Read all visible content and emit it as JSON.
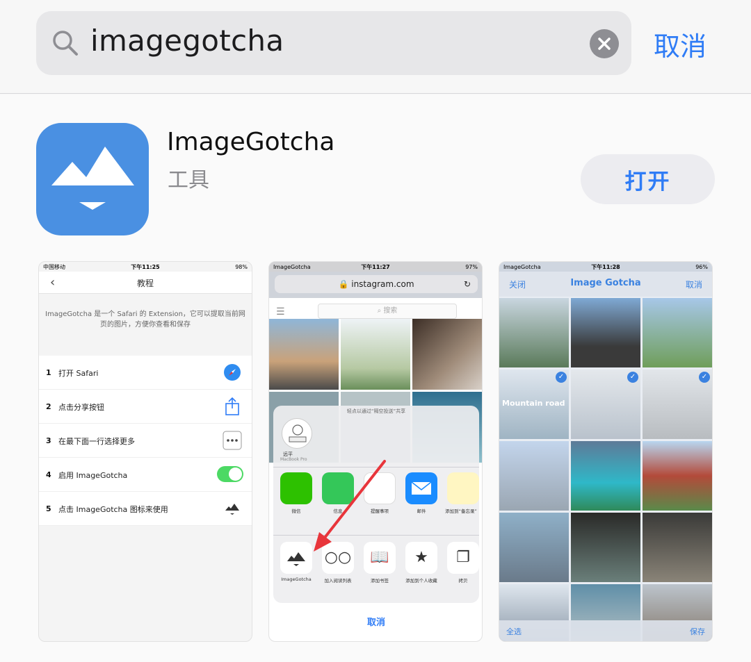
{
  "search": {
    "query": "imagegotcha",
    "cancel_label": "取消"
  },
  "app": {
    "name": "ImageGotcha",
    "category": "工具",
    "open_label": "打开",
    "brand_color": "#4a90e2"
  },
  "screenshots": {
    "shot1": {
      "status": {
        "carrier": "中国移动",
        "time": "下午11:25",
        "battery": "98%"
      },
      "title": "教程",
      "description": "ImageGotcha 是一个 Safari 的 Extension，它可以提取当前网页的图片，方便你查看和保存",
      "steps": [
        {
          "num": "1",
          "label": "打开 Safari",
          "icon": "compass-icon"
        },
        {
          "num": "2",
          "label": "点击分享按钮",
          "icon": "share-icon"
        },
        {
          "num": "3",
          "label": "在最下面一行选择更多",
          "icon": "more-icon"
        },
        {
          "num": "4",
          "label": "启用 ImageGotcha",
          "icon": "toggle-on"
        },
        {
          "num": "5",
          "label": "点击 ImageGotcha 图标来使用",
          "icon": "mountain-icon"
        }
      ]
    },
    "shot2": {
      "status": {
        "app": "ImageGotcha",
        "time": "下午11:27",
        "battery": "97%"
      },
      "url": "instagram.com",
      "search_placeholder": "搜索",
      "share_hint": "轻点以通过“隔空投送”共享",
      "airdrop_name": "远平",
      "airdrop_device": "MacBook Pro",
      "apps": [
        {
          "label": "微信",
          "color": "#2dc100"
        },
        {
          "label": "信息",
          "color": "#34c759"
        },
        {
          "label": "提醒事项",
          "color": "#ffffff"
        },
        {
          "label": "邮件",
          "color": "#1a8cff"
        },
        {
          "label": "添加到“备忘录”",
          "color": "#fff6c2"
        }
      ],
      "actions": [
        {
          "label": "ImageGotcha",
          "glyph": "▲"
        },
        {
          "label": "加入阅读列表",
          "glyph": "○○"
        },
        {
          "label": "添加书签",
          "glyph": "📖"
        },
        {
          "label": "添加到个人收藏",
          "glyph": "★"
        },
        {
          "label": "拷贝",
          "glyph": "❐"
        }
      ],
      "cancel_label": "取消"
    },
    "shot3": {
      "status": {
        "app": "ImageGotcha",
        "time": "下午11:28",
        "battery": "96%"
      },
      "close_label": "关闭",
      "title": "Image Gotcha",
      "cancel_label": "取消",
      "photo_caption": "Mountain road",
      "select_all_label": "全选",
      "save_label": "保存"
    }
  }
}
